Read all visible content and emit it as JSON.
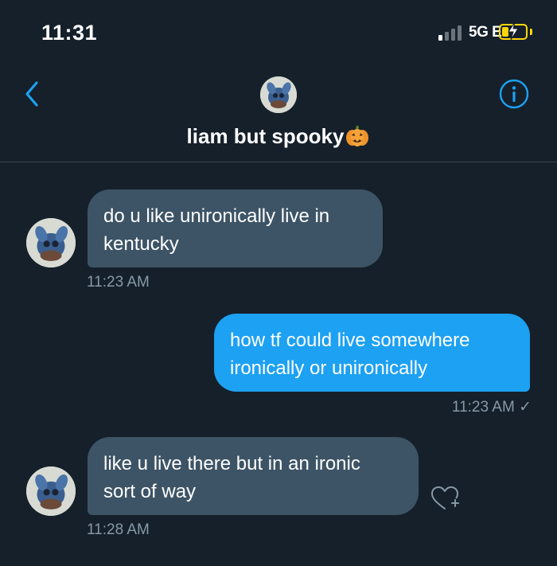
{
  "status_bar": {
    "time": "11:31",
    "network": "5G E",
    "battery_charging": true,
    "signal_bars_active": 1
  },
  "header": {
    "contact_name": "liam but spooky",
    "name_emoji": "pumpkin-jack-o-lantern",
    "back_icon": "chevron-left-icon",
    "info_icon": "info-circle-icon"
  },
  "messages": [
    {
      "direction": "received",
      "lines": [
        "do u like unironically live in",
        "kentucky"
      ],
      "time": "11:23 AM"
    },
    {
      "direction": "sent",
      "lines": [
        "how tf could live somewhere",
        "ironically or unironically"
      ],
      "time": "11:23 AM ✓"
    },
    {
      "direction": "received",
      "lines": [
        "like u live there but in an ironic",
        "sort of way"
      ],
      "time": "11:28 AM"
    }
  ],
  "colors": {
    "background": "#15202b",
    "received_bubble": "#3d5466",
    "sent_bubble": "#1da1f2",
    "accent": "#1da1f2",
    "timestamp": "#8899a6"
  }
}
